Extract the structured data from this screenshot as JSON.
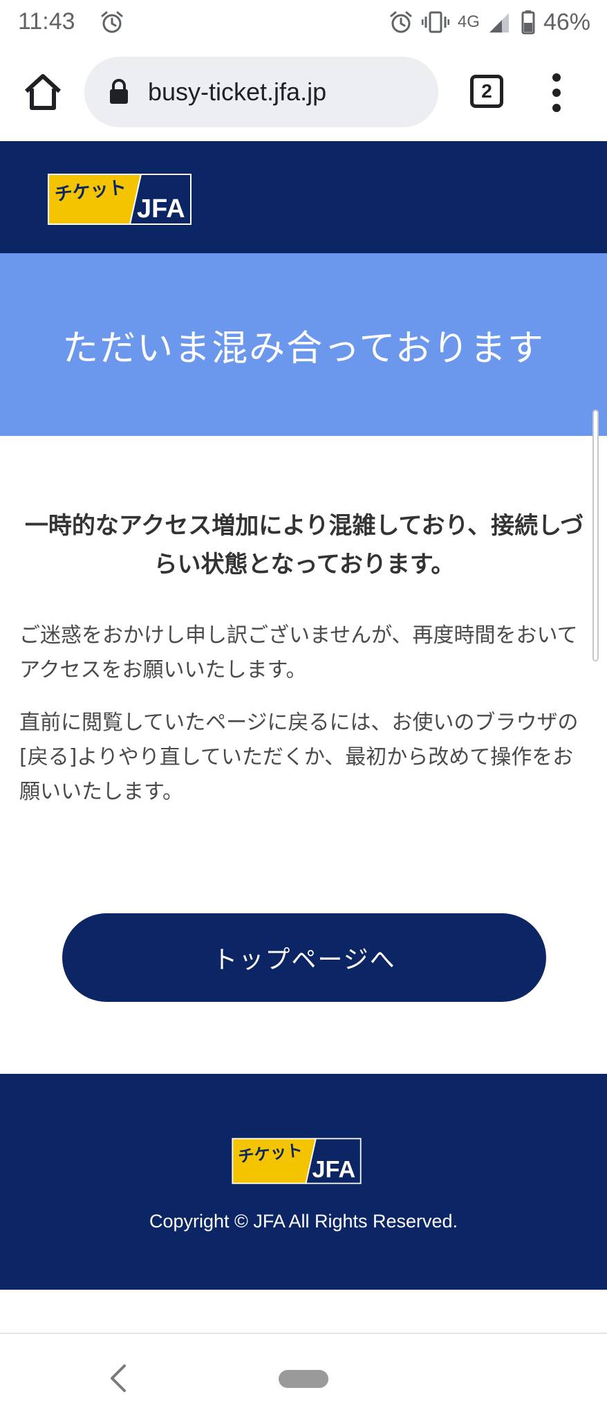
{
  "status_bar": {
    "time": "11:43",
    "network": "4G",
    "battery": "46%",
    "icons": [
      "alarm-icon",
      "vibrate-icon",
      "signal-icon",
      "battery-icon"
    ]
  },
  "browser": {
    "url": "busy-ticket.jfa.jp",
    "tab_count": "2"
  },
  "logo": {
    "kana": "チケット",
    "brand": "JFA",
    "yellow": "#f5c400",
    "navy": "#0b2565"
  },
  "hero": {
    "title": "ただいま混み合っております",
    "color": "#6b97ec"
  },
  "content": {
    "lead": "一時的なアクセス増加により混雑しており、接続しづらい状態となっております。",
    "paragraph1": "ご迷惑をおかけし申し訳ございませんが、再度時間をおいてアクセスをお願いいたします。",
    "paragraph2": "直前に閲覧していたページに戻るには、お使いのブラウザの[戻る]よりやり直していただくか、最初から改めて操作をお願いいたします。"
  },
  "top_button": {
    "label": "トップページへ"
  },
  "footer": {
    "copyright": "Copyright © JFA All Rights Reserved."
  }
}
